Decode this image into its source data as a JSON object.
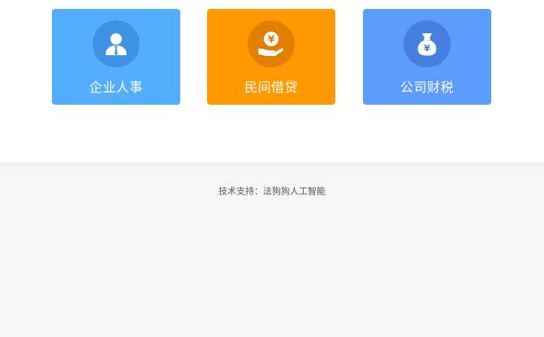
{
  "cards": [
    {
      "label": "企业人事",
      "icon": "person-icon",
      "color": "#55adfd",
      "badge_color": "#3f92e3"
    },
    {
      "label": "民间借贷",
      "icon": "hand-yen-coin-icon",
      "color": "#ff9801",
      "badge_color": "#e07f00"
    },
    {
      "label": "公司财税",
      "icon": "money-bag-yen-icon",
      "color": "#5c9cfd",
      "badge_color": "#477fde"
    }
  ],
  "footer": {
    "text": "技术支持：法狗狗人工智能"
  }
}
